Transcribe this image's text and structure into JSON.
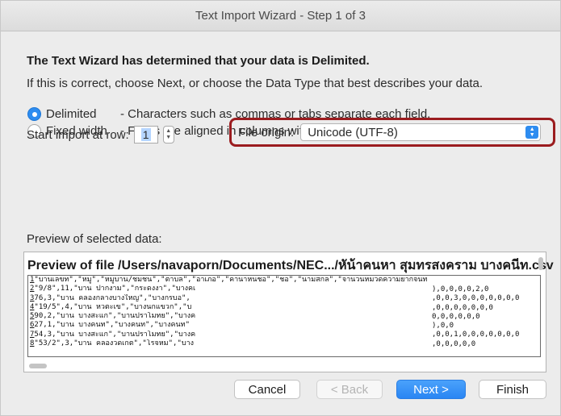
{
  "window": {
    "title": "Text Import Wizard - Step 1 of 3"
  },
  "intro": {
    "heading": "The Text Wizard has determined that your data is Delimited.",
    "subtext": "If this is correct, choose Next, or choose the Data Type that best describes your data."
  },
  "data_type": {
    "options": [
      {
        "label": "Delimited",
        "description": "- Characters such as commas or tabs separate each field.",
        "selected": true
      },
      {
        "label": "Fixed width",
        "description": "- Fields are aligned in columns with spaces between each field.",
        "selected": false
      }
    ]
  },
  "start_row": {
    "label": "Start import at row:",
    "value": "1"
  },
  "file_origin": {
    "label": "File origin:",
    "value": "Unicode (UTF-8)",
    "highlight_color": "#9b1c1f"
  },
  "preview": {
    "label": "Preview of selected data:",
    "file_title": "Preview of file /Users/navaporn/Documents/NEC.../หัน้าคนหา สุมทรสงคราม บางคนีท.csv",
    "rows": [
      {
        "num": "1",
        "left": "\"บานเลขท\",\"หมู\",\"หมูบาน/ชมชน\",\"ตาบล\",\"อาเภอ\",\"คานาหนชอ\",\"ชอ\",\"นามสกล\",\"จานวนหมวดความยากจนท",
        "right": ""
      },
      {
        "num": "2",
        "left": "\"9/8\",11,\"บาน ปากงาม\",\"กระดงงา\",\"บางคเ",
        "right": "),0,0,0,0,2,0"
      },
      {
        "num": "3",
        "left": "76,3,\"บาน คลองกลางบางใหญ\",\"บางกรบอ\",",
        "right": ",0,0,3,0,0,0,0,0,0,0"
      },
      {
        "num": "4",
        "left": "\"19/5\",4,\"บาน หวตะเข\",\"บางนกแขวก\",\"บ",
        "right": ",0,0,0,0,0,0,0"
      },
      {
        "num": "5",
        "left": "90,2,\"บาน บางสะแก\",\"บานปราโมทย\",\"บางค",
        "right": "0,0,0,0,0,0"
      },
      {
        "num": "6",
        "left": "27,1,\"บาน บางคนท\",\"บางคนท\",\"บางคนท\"",
        "right": "),0,0"
      },
      {
        "num": "7",
        "left": "54,3,\"บาน บางสะแก\",\"บานปราโมทย\",\"บางค",
        "right": ",0,0,1,0,0,0,0,0,0,0"
      },
      {
        "num": "8",
        "left": "\"53/2\",3,\"บาน คลองวดเกต\",\"โรจหม\",\"บาง",
        "right": ",0,0,0,0,0"
      }
    ]
  },
  "buttons": {
    "cancel": "Cancel",
    "back": "< Back",
    "next": "Next >",
    "finish": "Finish"
  }
}
